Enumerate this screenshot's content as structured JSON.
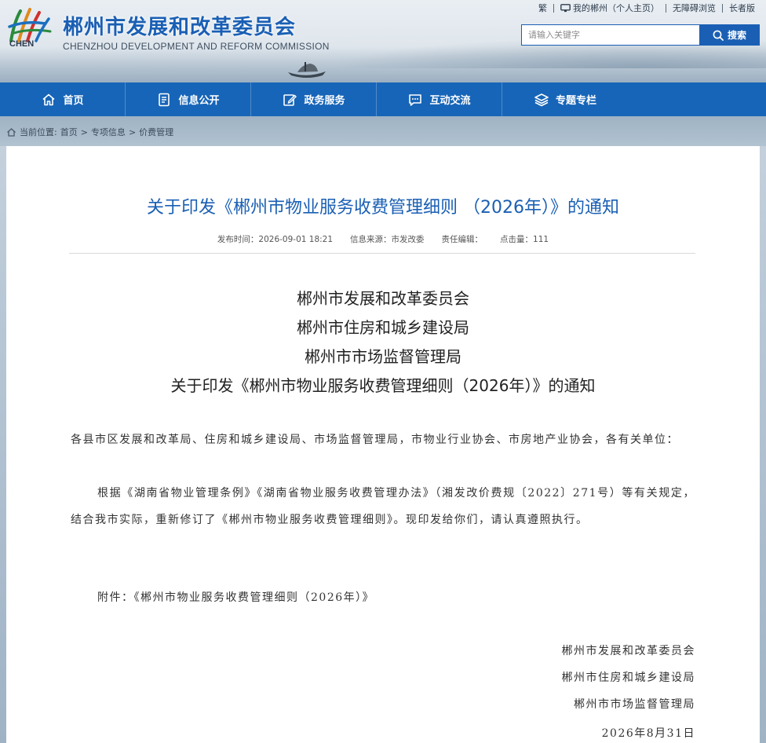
{
  "header": {
    "logo_text": "CHEN",
    "site_title": "郴州市发展和改革委员会",
    "site_subtitle": "CHENZHOU DEVELOPMENT AND REFORM COMMISSION",
    "toplinks": [
      "繁",
      "我的郴州（个人主页）",
      "无障碍浏览",
      "长者版"
    ],
    "search_placeholder": "请输入关键字",
    "search_button": "搜索"
  },
  "nav": [
    {
      "label": "首页",
      "icon": "home-icon"
    },
    {
      "label": "信息公开",
      "icon": "document-icon"
    },
    {
      "label": "政务服务",
      "icon": "edit-icon"
    },
    {
      "label": "互动交流",
      "icon": "chat-icon"
    },
    {
      "label": "专题专栏",
      "icon": "layers-icon"
    }
  ],
  "breadcrumb": {
    "prefix": "当前位置:",
    "items": [
      "首页",
      "专项信息",
      "价费管理"
    ],
    "separator": ">"
  },
  "article": {
    "title": "关于印发《郴州市物业服务收费管理细则 （2026年）》的通知",
    "meta": {
      "publish_time": "发布时间：2026-09-01 18:21",
      "source": "信息来源：市发改委",
      "editor": "责任编辑：",
      "hits": "点击量：111"
    },
    "doc_heading": [
      "郴州市发展和改革委员会",
      "郴州市住房和城乡建设局",
      "郴州市市场监督管理局",
      "关于印发《郴州市物业服务收费管理细则（2026年）》的通知"
    ],
    "addressee": "各县市区发展和改革局、住房和城乡建设局、市场监督管理局，市物业行业协会、市房地产业协会，各有关单位：",
    "paragraph": "根据《湖南省物业管理条例》《湖南省物业服务收费管理办法》（湘发改价费规〔2022〕271号）等有关规定，结合我市实际，重新修订了《郴州市物业服务收费管理细则》。现印发给你们，请认真遵照执行。",
    "attachment": "附件：《郴州市物业服务收费管理细则（2026年）》",
    "signatures": [
      "郴州市发展和改革委员会",
      "郴州市住房和城乡建设局",
      "郴州市市场监督管理局"
    ],
    "date": "2026年8月31日"
  }
}
